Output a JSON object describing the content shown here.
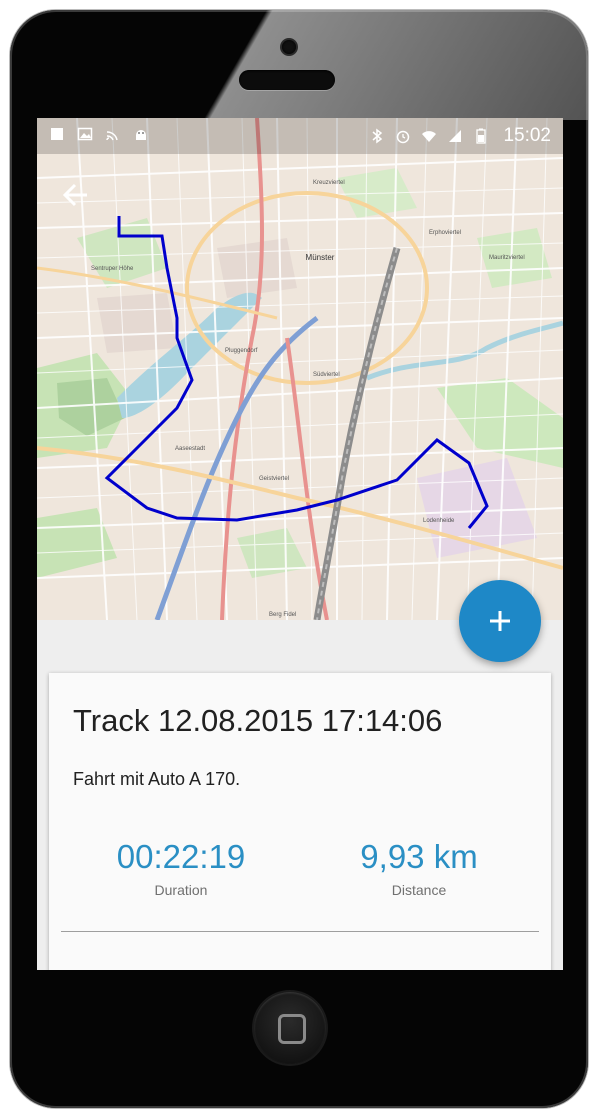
{
  "status_bar": {
    "time": "15:02",
    "left_icons": [
      "notification-square-icon",
      "image-icon",
      "cast-icon",
      "android-icon"
    ],
    "right_icons": [
      "bluetooth-icon",
      "alarm-icon",
      "wifi-icon",
      "signal-icon",
      "battery-icon"
    ]
  },
  "toolbar": {
    "back_icon": "arrow-back-icon"
  },
  "map": {
    "labels": {
      "city": "Münster",
      "north": "Kreuzviertel",
      "northeast": "Erphoviertel",
      "east": "Mauritzviertel",
      "west": "Sentruper Höhe",
      "center_w": "Pluggendorf",
      "south": "Südviertel",
      "southwest": "Aaseestadt",
      "geist": "Geistviertel",
      "southeast": "Lodenheide",
      "berg": "Berg Fidel"
    },
    "route_color": "#0000cc"
  },
  "fab": {
    "label": "+"
  },
  "track": {
    "title": "Track 12.08.2015 17:14:06",
    "description": "Fahrt mit Auto A 170.",
    "duration_value": "00:22:19",
    "duration_label": "Duration",
    "distance_value": "9,93 km",
    "distance_label": "Distance"
  },
  "colors": {
    "accent": "#1e88c7",
    "stat_value": "#2a8fc4"
  }
}
